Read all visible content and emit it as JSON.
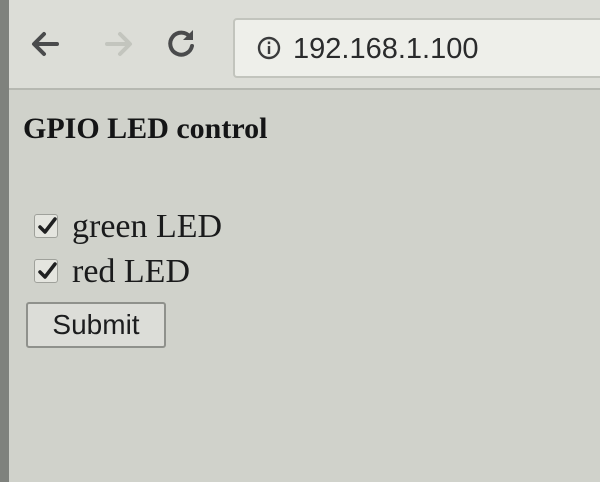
{
  "browser": {
    "url": "192.168.1.100",
    "icons": {
      "back": "back-arrow-icon",
      "forward": "forward-arrow-icon",
      "reload": "reload-icon",
      "site_info": "info-icon"
    }
  },
  "page": {
    "title": "GPIO LED control",
    "checkboxes": [
      {
        "label": "green LED",
        "checked": true
      },
      {
        "label": "red LED",
        "checked": true
      }
    ],
    "submit_label": "Submit"
  },
  "colors": {
    "page_background": "#d0d2cb",
    "toolbar_background": "#dcddd7",
    "text": "#141516"
  }
}
